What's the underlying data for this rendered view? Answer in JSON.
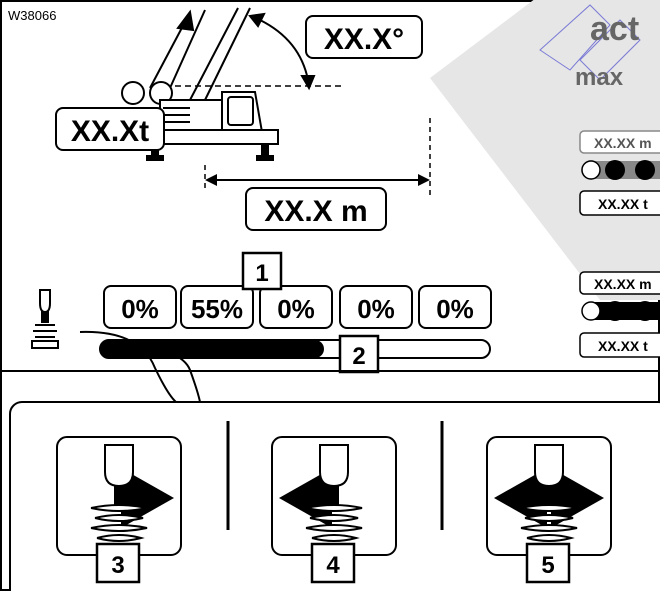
{
  "figure_id": "W38066",
  "display": {
    "angle_readout": "XX.X°",
    "load_readout": "XX.Xt",
    "radius_readout": "XX.X m",
    "act_label": "act",
    "max_label": "max"
  },
  "side_panel": {
    "group1": {
      "top": "XX.XX m",
      "bottom": "XX.XX t"
    },
    "group2": {
      "top": "XX.XX m",
      "bottom": "XX.XX t"
    }
  },
  "percent_boxes": [
    "0%",
    "55%",
    "0%",
    "0%",
    "0%"
  ],
  "callouts": [
    "1",
    "2",
    "3",
    "4",
    "5"
  ],
  "colors": {
    "ink": "#000000",
    "watermark": "#e6e6e6",
    "watermark_outline": "#7a7ad6",
    "bar_fill": "#000000"
  }
}
